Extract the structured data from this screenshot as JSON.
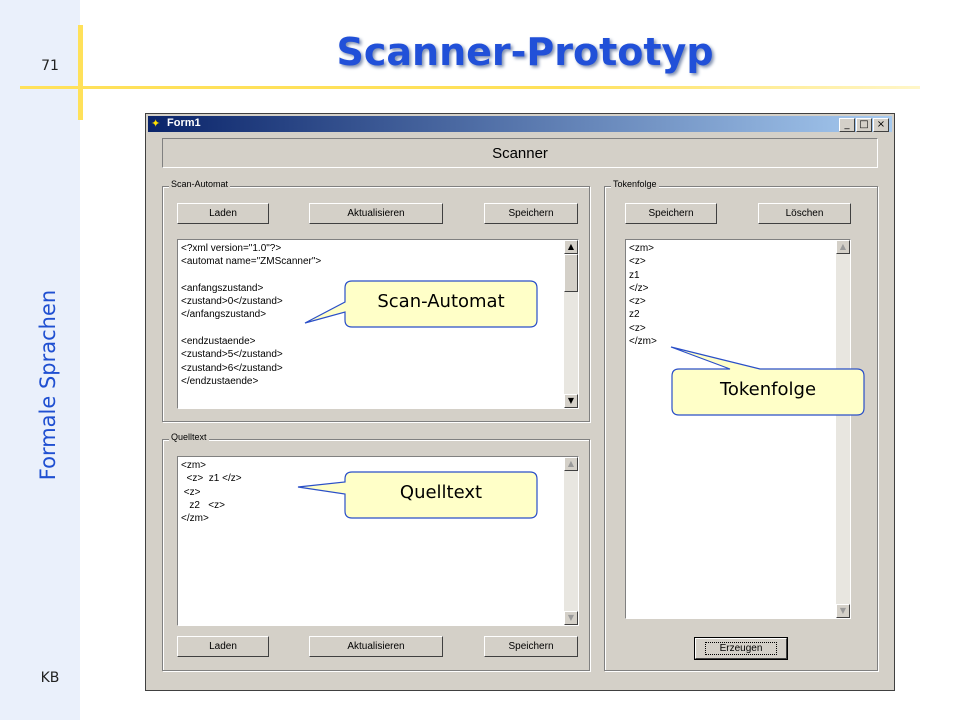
{
  "slide": {
    "page_number": "71",
    "title": "Scanner-Prototyp",
    "side_title": "Formale Sprachen",
    "author": "KB"
  },
  "window": {
    "title": "Form1",
    "controls": {
      "minimize": "_",
      "maximize": "□",
      "close": "×"
    },
    "header": "Scanner"
  },
  "scan_automat": {
    "label": "Scan-Automat",
    "buttons": {
      "load": "Laden",
      "update": "Aktualisieren",
      "save": "Speichern"
    },
    "lines": [
      "<?xml version=\"1.0\"?>",
      "<automat name=\"ZMScanner\">",
      "",
      "<anfangszustand>",
      "<zustand>0</zustand>",
      "</anfangszustand>",
      "",
      "<endzustaende>",
      "<zustand>5</zustand>",
      "<zustand>6</zustand>",
      "</endzustaende>"
    ]
  },
  "quelltext": {
    "label": "Quelltext",
    "buttons": {
      "load": "Laden",
      "update": "Aktualisieren",
      "save": "Speichern"
    },
    "lines": [
      "<zm>",
      "  <z>  z1 </z>",
      " <z>",
      "   z2   <z>",
      "</zm>"
    ]
  },
  "tokenfolge": {
    "label": "Tokenfolge",
    "buttons": {
      "save": "Speichern",
      "delete": "Löschen",
      "generate": "Erzeugen"
    },
    "lines": [
      "<zm>",
      "<z>",
      "z1",
      "</z>",
      "<z>",
      "z2",
      "<z>",
      "</zm>"
    ]
  },
  "callouts": {
    "scan_automat": "Scan-Automat",
    "quelltext": "Quelltext",
    "tokenfolge": "Tokenfolge"
  },
  "colors": {
    "slide_title": "#2150d8",
    "side_title": "#1f4fd1",
    "accent_line": "#ffe15a",
    "callout_fill": "#ffffc8",
    "callout_border": "#2a4fc8",
    "window_face": "#d4d0c8",
    "titlebar": "#0a246a"
  }
}
